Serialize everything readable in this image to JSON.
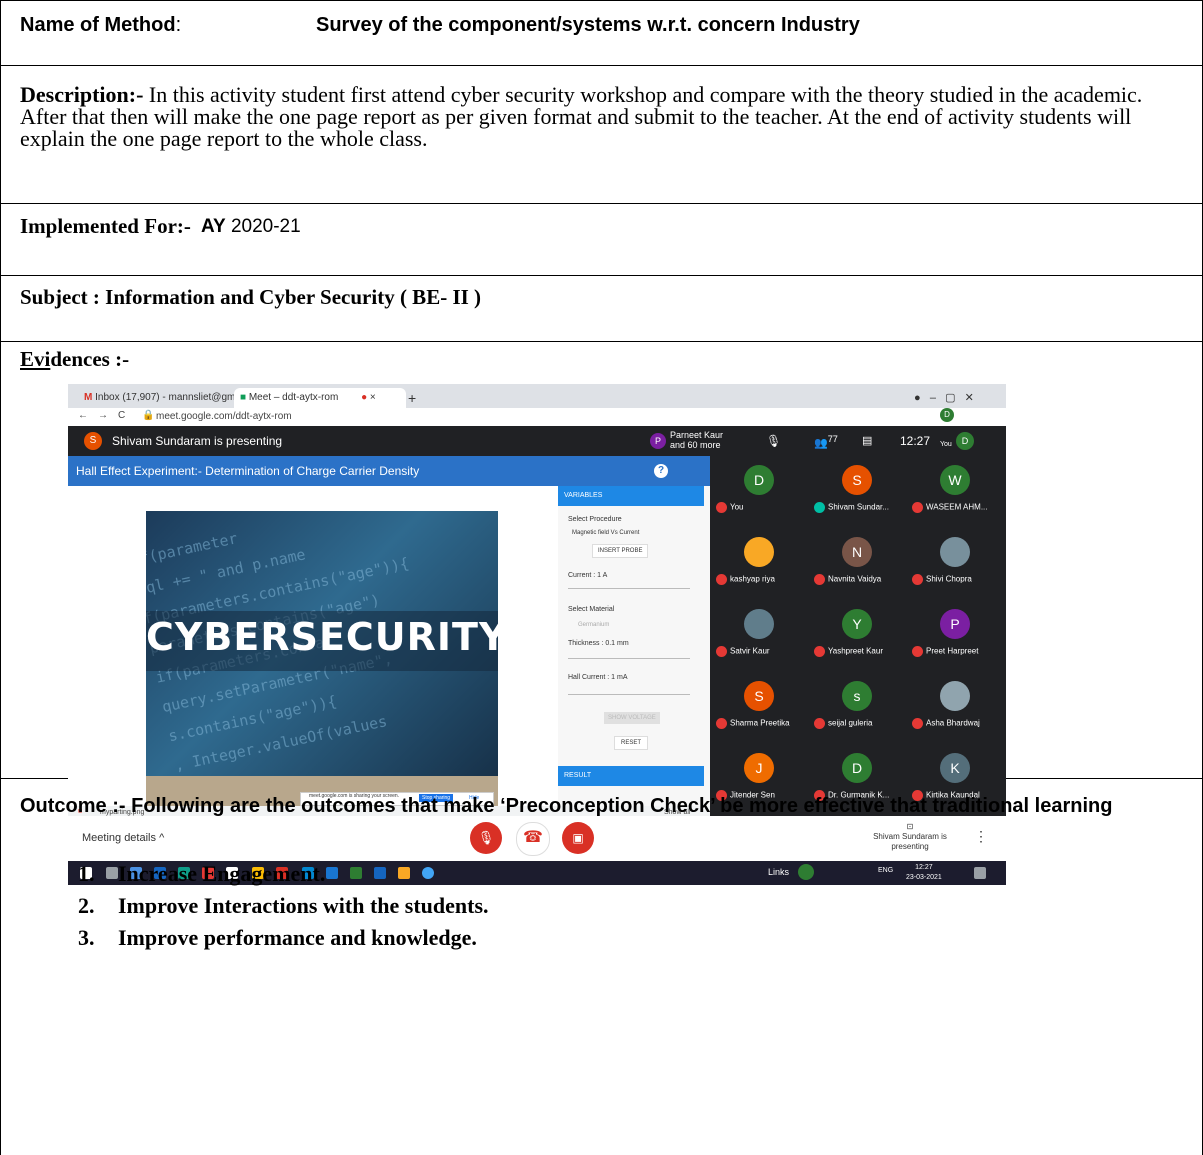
{
  "method": {
    "label": "Name of Method",
    "colon": ":",
    "value": "Survey of the component/systems w.r.t. concern Industry"
  },
  "description": {
    "label": "Description:-",
    "text": " In this activity student first attend cyber security workshop and compare with the theory studied in the academic. After that then will make the one page report as per given format and submit to the teacher. At the end of activity students will explain the one page report to the whole class."
  },
  "implemented": {
    "label": "Implemented For:-",
    "ay_label": "AY",
    "ay_value": "2020-21"
  },
  "subject": {
    "text": "Subject : Information and Cyber Security ( BE- II )"
  },
  "evidences": {
    "label_underlined": "Evi",
    "label_rest": "dences :-"
  },
  "screenshot": {
    "tab1": "Inbox (17,907) - mannsliet@gma",
    "tab2": "Meet – ddt-aytx-rom",
    "url": "meet.google.com/ddt-aytx-rom",
    "presenter_initial": "S",
    "presenting": "Shivam Sundaram is presenting",
    "participants_label": "Parneet Kaur and 60 more",
    "participant_count": "77",
    "time": "12:27",
    "you_label": "You",
    "slide_title": "Hall Effect Experiment:- Determination of Charge Carrier Density",
    "slide_word": "CYBERSECURITY",
    "code_lines": [
      "if(parameter",
      "hql += \" and p.name",
      "f(parameters.contains(\"age\")){",
      "parameters.contains(\"age\")",
      "if(parameters.contai",
      "query.setParameter(\"name\",",
      "s.contains(\"age\")){",
      ", Integer.valueOf(values"
    ],
    "panel": {
      "header": "VARIABLES",
      "select_procedure": "Select Procedure",
      "procedure_value": "Magnetic field Vs Current",
      "insert_probe": "INSERT PROBE",
      "current": "Current : 1 A",
      "select_material": "Select Material",
      "material_value": "Germanium",
      "thickness": "Thickness : 0.1 mm",
      "hall_current": "Hall Current : 1 mA",
      "show_voltage": "SHOW VOLTAGE",
      "reset": "RESET",
      "result": "RESULT"
    },
    "sharing_text": "meet.google.com is sharing your screen.",
    "stop_sharing": "Stop sharing",
    "hide": "Hide",
    "download_file": "myparting.png",
    "show_all": "Show all",
    "meeting_details": "Meeting details",
    "presenting_bottom": "Shivam Sundaram is presenting",
    "links": "Links",
    "lang": "ENG",
    "task_time": "12:27",
    "task_date": "23-03-2021",
    "participants": [
      {
        "initial": "D",
        "name": "You",
        "color": "#2e7d32"
      },
      {
        "initial": "S",
        "name": "Shivam Sundar...",
        "color": "#e65100"
      },
      {
        "initial": "W",
        "name": "WASEEM AHM...",
        "color": "#2e7d32"
      },
      {
        "initial": "",
        "name": "kashyap riya",
        "color": "#f9a825"
      },
      {
        "initial": "N",
        "name": "Navnita Vaidya",
        "color": "#795548"
      },
      {
        "initial": "",
        "name": "Shivi Chopra",
        "color": "#78909c"
      },
      {
        "initial": "",
        "name": "Satvir Kaur",
        "color": "#607d8b"
      },
      {
        "initial": "Y",
        "name": "Yashpreet Kaur",
        "color": "#2e7d32"
      },
      {
        "initial": "P",
        "name": "Preet Harpreet",
        "color": "#7b1fa2"
      },
      {
        "initial": "S",
        "name": "Sharma Preetika",
        "color": "#e65100"
      },
      {
        "initial": "s",
        "name": "seijal guleria",
        "color": "#2e7d32"
      },
      {
        "initial": "",
        "name": "Asha Bhardwaj",
        "color": "#90a4ae"
      },
      {
        "initial": "J",
        "name": "Jitender Sen",
        "color": "#ef6c00"
      },
      {
        "initial": "D",
        "name": "Dr. Gurmanik K...",
        "color": "#2e7d32"
      },
      {
        "initial": "K",
        "name": "Kirtika Kaundal",
        "color": "#546e7a"
      }
    ]
  },
  "outcome": {
    "text": "Outcome :-  Following are the outcomes that make ‘Preconception Check’ be more effective that traditional learning",
    "items": [
      "Increase Engagement.",
      "Improve Interactions with the students.",
      "Improve performance and knowledge."
    ],
    "numbers": [
      "1.",
      "2.",
      "3."
    ]
  },
  "colors": {
    "meet_blue": "#2b72c7",
    "end_red": "#d93025",
    "meet_dark": "#202124"
  }
}
